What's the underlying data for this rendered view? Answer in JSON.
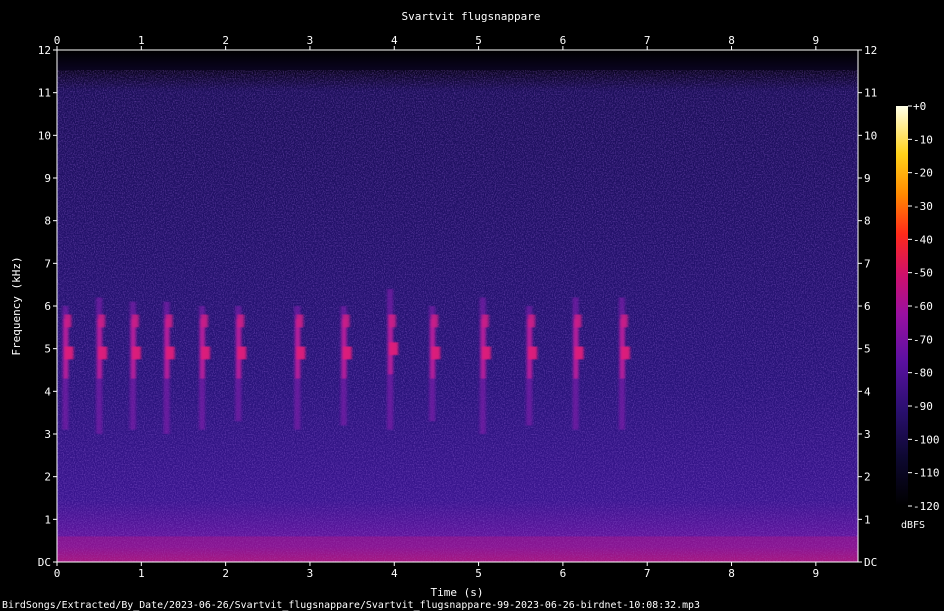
{
  "chart_data": {
    "type": "heatmap",
    "title": "Svartvit flugsnappare",
    "xlabel": "Time (s)",
    "ylabel": "Frequency (kHz)",
    "xlim": [
      0,
      9.5
    ],
    "ylim": [
      0,
      12
    ],
    "x_ticks": [
      "0",
      "1",
      "2",
      "3",
      "4",
      "5",
      "6",
      "7",
      "8",
      "9"
    ],
    "y_ticks": [
      "DC",
      "1",
      "2",
      "3",
      "4",
      "5",
      "6",
      "7",
      "8",
      "9",
      "10",
      "11",
      "12"
    ],
    "colorbar": {
      "label": "dBFS",
      "ticks": [
        "+0",
        "-10",
        "-20",
        "-30",
        "-40",
        "-50",
        "-60",
        "-70",
        "-80",
        "-90",
        "-100",
        "-110",
        "-120"
      ],
      "range": [
        -120,
        0
      ],
      "colormap": [
        "#000000",
        "#0d0830",
        "#2a0f70",
        "#5a10a0",
        "#9a10a0",
        "#d0106a",
        "#ff2a1a",
        "#ff8a00",
        "#ffd21a",
        "#ffffe8"
      ]
    },
    "calls": [
      {
        "t": 0.1,
        "f_low": 3.1,
        "f_high": 6.0,
        "peak_khz": 4.9
      },
      {
        "t": 0.5,
        "f_low": 3.0,
        "f_high": 6.2,
        "peak_khz": 4.9
      },
      {
        "t": 0.9,
        "f_low": 3.1,
        "f_high": 6.1,
        "peak_khz": 4.9
      },
      {
        "t": 1.3,
        "f_low": 3.0,
        "f_high": 6.1,
        "peak_khz": 4.9
      },
      {
        "t": 1.72,
        "f_low": 3.1,
        "f_high": 6.0,
        "peak_khz": 4.9
      },
      {
        "t": 2.15,
        "f_low": 3.3,
        "f_high": 6.0,
        "peak_khz": 4.9
      },
      {
        "t": 2.85,
        "f_low": 3.1,
        "f_high": 6.0,
        "peak_khz": 4.9
      },
      {
        "t": 3.4,
        "f_low": 3.2,
        "f_high": 6.0,
        "peak_khz": 4.9
      },
      {
        "t": 3.95,
        "f_low": 3.1,
        "f_high": 6.4,
        "peak_khz": 5.0
      },
      {
        "t": 4.45,
        "f_low": 3.3,
        "f_high": 6.0,
        "peak_khz": 4.9
      },
      {
        "t": 5.05,
        "f_low": 3.0,
        "f_high": 6.2,
        "peak_khz": 4.9
      },
      {
        "t": 5.6,
        "f_low": 3.2,
        "f_high": 6.0,
        "peak_khz": 4.9
      },
      {
        "t": 6.15,
        "f_low": 3.1,
        "f_high": 6.2,
        "peak_khz": 4.9
      },
      {
        "t": 6.7,
        "f_low": 3.1,
        "f_high": 6.2,
        "peak_khz": 4.9
      }
    ],
    "noise_floor_dbfs": -105,
    "low_freq_band_khz": [
      0,
      0.6
    ]
  },
  "footer": {
    "path": "BirdSongs/Extracted/By_Date/2023-06-26/Svartvit_flugsnappare/Svartvit_flugsnappare-99-2023-06-26-birdnet-10:08:32.mp3"
  }
}
